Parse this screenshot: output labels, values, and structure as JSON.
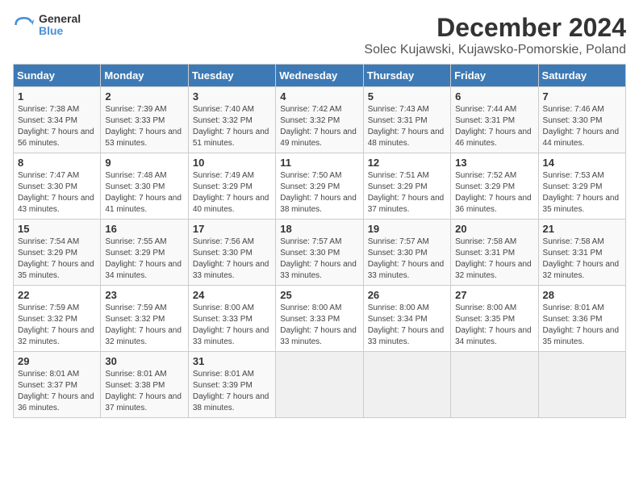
{
  "logo": {
    "general": "General",
    "blue": "Blue"
  },
  "header": {
    "title": "December 2024",
    "subtitle": "Solec Kujawski, Kujawsko-Pomorskie, Poland"
  },
  "weekdays": [
    "Sunday",
    "Monday",
    "Tuesday",
    "Wednesday",
    "Thursday",
    "Friday",
    "Saturday"
  ],
  "weeks": [
    [
      {
        "day": "1",
        "sunrise": "7:38 AM",
        "sunset": "3:34 PM",
        "daylight": "7 hours and 56 minutes."
      },
      {
        "day": "2",
        "sunrise": "7:39 AM",
        "sunset": "3:33 PM",
        "daylight": "7 hours and 53 minutes."
      },
      {
        "day": "3",
        "sunrise": "7:40 AM",
        "sunset": "3:32 PM",
        "daylight": "7 hours and 51 minutes."
      },
      {
        "day": "4",
        "sunrise": "7:42 AM",
        "sunset": "3:32 PM",
        "daylight": "7 hours and 49 minutes."
      },
      {
        "day": "5",
        "sunrise": "7:43 AM",
        "sunset": "3:31 PM",
        "daylight": "7 hours and 48 minutes."
      },
      {
        "day": "6",
        "sunrise": "7:44 AM",
        "sunset": "3:31 PM",
        "daylight": "7 hours and 46 minutes."
      },
      {
        "day": "7",
        "sunrise": "7:46 AM",
        "sunset": "3:30 PM",
        "daylight": "7 hours and 44 minutes."
      }
    ],
    [
      {
        "day": "8",
        "sunrise": "7:47 AM",
        "sunset": "3:30 PM",
        "daylight": "7 hours and 43 minutes."
      },
      {
        "day": "9",
        "sunrise": "7:48 AM",
        "sunset": "3:30 PM",
        "daylight": "7 hours and 41 minutes."
      },
      {
        "day": "10",
        "sunrise": "7:49 AM",
        "sunset": "3:29 PM",
        "daylight": "7 hours and 40 minutes."
      },
      {
        "day": "11",
        "sunrise": "7:50 AM",
        "sunset": "3:29 PM",
        "daylight": "7 hours and 38 minutes."
      },
      {
        "day": "12",
        "sunrise": "7:51 AM",
        "sunset": "3:29 PM",
        "daylight": "7 hours and 37 minutes."
      },
      {
        "day": "13",
        "sunrise": "7:52 AM",
        "sunset": "3:29 PM",
        "daylight": "7 hours and 36 minutes."
      },
      {
        "day": "14",
        "sunrise": "7:53 AM",
        "sunset": "3:29 PM",
        "daylight": "7 hours and 35 minutes."
      }
    ],
    [
      {
        "day": "15",
        "sunrise": "7:54 AM",
        "sunset": "3:29 PM",
        "daylight": "7 hours and 35 minutes."
      },
      {
        "day": "16",
        "sunrise": "7:55 AM",
        "sunset": "3:29 PM",
        "daylight": "7 hours and 34 minutes."
      },
      {
        "day": "17",
        "sunrise": "7:56 AM",
        "sunset": "3:30 PM",
        "daylight": "7 hours and 33 minutes."
      },
      {
        "day": "18",
        "sunrise": "7:57 AM",
        "sunset": "3:30 PM",
        "daylight": "7 hours and 33 minutes."
      },
      {
        "day": "19",
        "sunrise": "7:57 AM",
        "sunset": "3:30 PM",
        "daylight": "7 hours and 33 minutes."
      },
      {
        "day": "20",
        "sunrise": "7:58 AM",
        "sunset": "3:31 PM",
        "daylight": "7 hours and 32 minutes."
      },
      {
        "day": "21",
        "sunrise": "7:58 AM",
        "sunset": "3:31 PM",
        "daylight": "7 hours and 32 minutes."
      }
    ],
    [
      {
        "day": "22",
        "sunrise": "7:59 AM",
        "sunset": "3:32 PM",
        "daylight": "7 hours and 32 minutes."
      },
      {
        "day": "23",
        "sunrise": "7:59 AM",
        "sunset": "3:32 PM",
        "daylight": "7 hours and 32 minutes."
      },
      {
        "day": "24",
        "sunrise": "8:00 AM",
        "sunset": "3:33 PM",
        "daylight": "7 hours and 33 minutes."
      },
      {
        "day": "25",
        "sunrise": "8:00 AM",
        "sunset": "3:33 PM",
        "daylight": "7 hours and 33 minutes."
      },
      {
        "day": "26",
        "sunrise": "8:00 AM",
        "sunset": "3:34 PM",
        "daylight": "7 hours and 33 minutes."
      },
      {
        "day": "27",
        "sunrise": "8:00 AM",
        "sunset": "3:35 PM",
        "daylight": "7 hours and 34 minutes."
      },
      {
        "day": "28",
        "sunrise": "8:01 AM",
        "sunset": "3:36 PM",
        "daylight": "7 hours and 35 minutes."
      }
    ],
    [
      {
        "day": "29",
        "sunrise": "8:01 AM",
        "sunset": "3:37 PM",
        "daylight": "7 hours and 36 minutes."
      },
      {
        "day": "30",
        "sunrise": "8:01 AM",
        "sunset": "3:38 PM",
        "daylight": "7 hours and 37 minutes."
      },
      {
        "day": "31",
        "sunrise": "8:01 AM",
        "sunset": "3:39 PM",
        "daylight": "7 hours and 38 minutes."
      },
      null,
      null,
      null,
      null
    ]
  ],
  "labels": {
    "sunrise": "Sunrise: ",
    "sunset": "Sunset: ",
    "daylight": "Daylight: "
  }
}
